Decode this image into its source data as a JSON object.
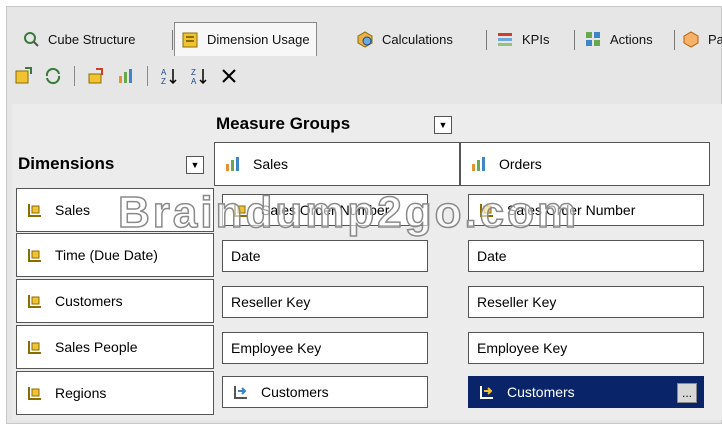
{
  "tabs": [
    {
      "label": "Cube Structure",
      "icon": "cube-structure-icon",
      "active": false
    },
    {
      "label": "Dimension Usage",
      "icon": "dimension-usage-icon",
      "active": true
    },
    {
      "label": "Calculations",
      "icon": "calculations-icon",
      "active": false
    },
    {
      "label": "KPIs",
      "icon": "kpis-icon",
      "active": false
    },
    {
      "label": "Actions",
      "icon": "actions-icon",
      "active": false
    },
    {
      "label": "Pa",
      "icon": "partitions-icon",
      "active": false
    }
  ],
  "toolbar": {
    "icons": [
      "add-cube-dimension-icon",
      "refresh-icon",
      "dimension-wizard-icon",
      "measure-group-icon",
      "sort-ascending-icon",
      "sort-descending-icon",
      "delete-icon"
    ]
  },
  "grid": {
    "measure_groups_title": "Measure Groups",
    "dimensions_title": "Dimensions",
    "measure_groups": [
      "Sales",
      "Orders"
    ],
    "dimensions": [
      "Sales",
      "Time (Due Date)",
      "Customers",
      "Sales People",
      "Regions"
    ],
    "cells": [
      [
        "Sales Order Number",
        "Sales Order Number"
      ],
      [
        "Date",
        "Date"
      ],
      [
        "Reseller Key",
        "Reseller Key"
      ],
      [
        "Employee Key",
        "Employee Key"
      ],
      [
        "Customers",
        "Customers"
      ]
    ],
    "selected_cell_button": "...",
    "watermark": "Braindump2go.com"
  },
  "colors": {
    "selection": "#0a246a",
    "background": "#ececec",
    "border": "#555555"
  }
}
